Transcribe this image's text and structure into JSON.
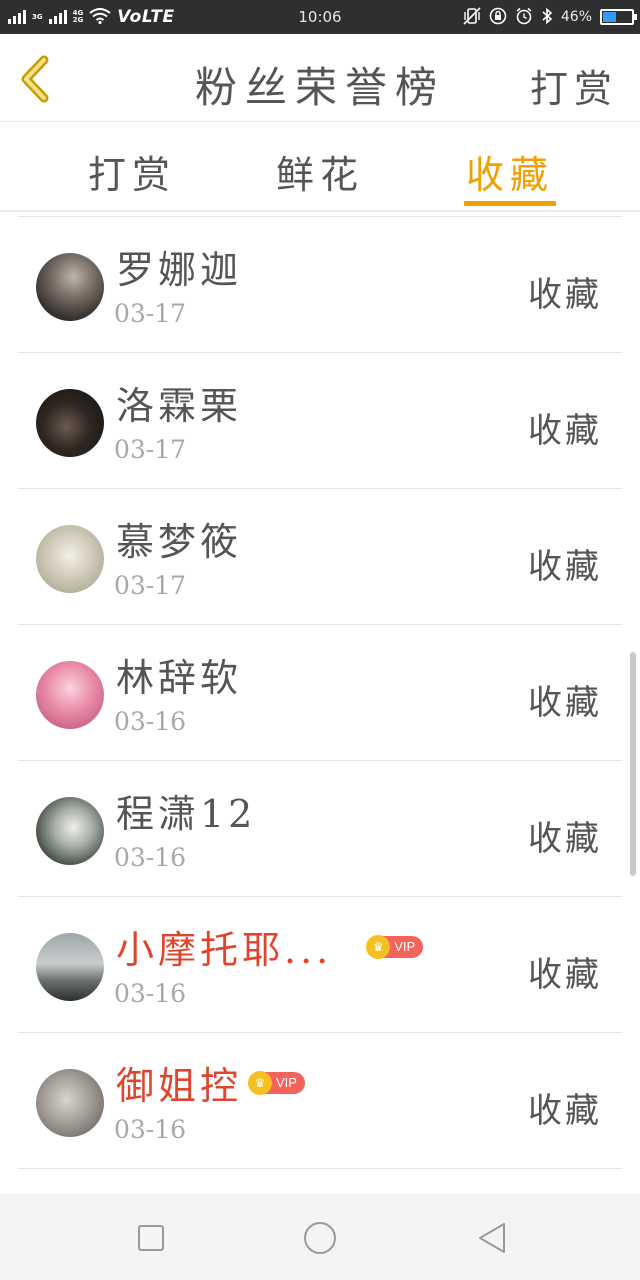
{
  "status_bar": {
    "net_top": "3G",
    "net_bottom": "4G",
    "net_bottom2": "2G",
    "volte": "VoLTE",
    "time": "10:06",
    "battery_text": "46%",
    "battery_level": 0.46
  },
  "header": {
    "title": "粉丝荣誉榜",
    "action_label": "打赏"
  },
  "tabs": [
    {
      "label": "打赏",
      "active": false
    },
    {
      "label": "鲜花",
      "active": false
    },
    {
      "label": "收藏",
      "active": true
    }
  ],
  "list": {
    "rows": [
      {
        "name": "罗娜迦",
        "date": "03-17",
        "action": "收藏",
        "vip": false
      },
      {
        "name": "洛霖栗",
        "date": "03-17",
        "action": "收藏",
        "vip": false
      },
      {
        "name": "慕梦筱",
        "date": "03-17",
        "action": "收藏",
        "vip": false
      },
      {
        "name": "林辞软",
        "date": "03-16",
        "action": "收藏",
        "vip": false
      },
      {
        "name": "程潇12",
        "date": "03-16",
        "action": "收藏",
        "vip": false
      },
      {
        "name": "小摩托耶...",
        "date": "03-16",
        "action": "收藏",
        "vip": true
      },
      {
        "name": "御姐控",
        "date": "03-16",
        "action": "收藏",
        "vip": true
      }
    ],
    "vip_label": "VIP"
  },
  "colors": {
    "accent": "#f0a000",
    "vip_name": "#e0442d",
    "text": "#555555",
    "date": "#a8a8a8"
  }
}
